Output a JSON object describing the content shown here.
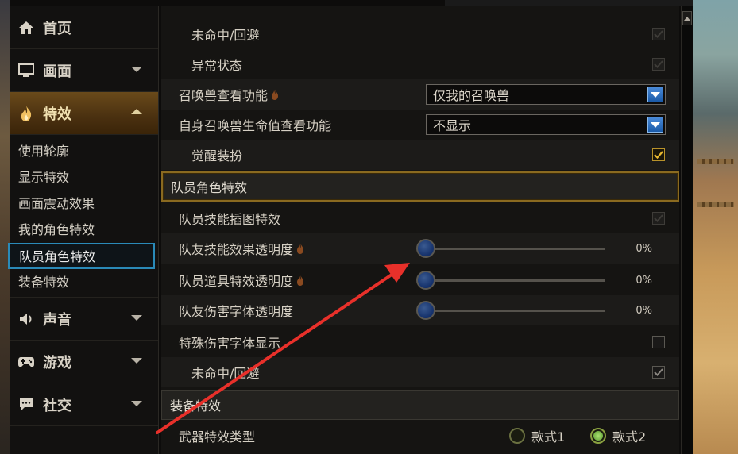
{
  "sidebar": {
    "categories": [
      {
        "label": "首页",
        "icon": "home-icon"
      },
      {
        "label": "画面",
        "icon": "monitor-icon"
      },
      {
        "label": "特效",
        "icon": "flame-icon"
      },
      {
        "label": "声音",
        "icon": "speaker-icon"
      },
      {
        "label": "游戏",
        "icon": "gamepad-icon"
      },
      {
        "label": "社交",
        "icon": "chat-icon"
      }
    ],
    "effects_sub": [
      "使用轮廓",
      "显示特效",
      "画面震动效果",
      "我的角色特效",
      "队员角色特效",
      "装备特效"
    ],
    "selected_sub": "队员角色特效"
  },
  "settings": {
    "miss_dodge_label": "未命中/回避",
    "abnormal_status_label": "异常状态",
    "summon_view_label": "召唤兽查看功能",
    "summon_view_value": "仅我的召唤兽",
    "summon_hp_label": "自身召唤兽生命值查看功能",
    "summon_hp_value": "不显示",
    "awaken_outfit_label": "觉醒装扮",
    "party_section_title": "队员角色特效",
    "party_skill_cutin_label": "队员技能插图特效",
    "ally_skill_opacity_label": "队友技能效果透明度",
    "ally_skill_opacity_value": "0%",
    "party_item_opacity_label": "队员道具特效透明度",
    "party_item_opacity_value": "0%",
    "ally_damage_font_opacity_label": "队友伤害字体透明度",
    "ally_damage_font_opacity_value": "0%",
    "special_damage_font_label": "特殊伤害字体显示",
    "party_miss_dodge_label": "未命中/回避",
    "equipment_section_title": "装备特效",
    "weapon_effect_type_label": "武器特效类型",
    "weapon_style1": "款式1",
    "weapon_style2": "款式2"
  },
  "colors": {
    "accent_gold": "#b8922a",
    "selected_blue": "#2a8ab8",
    "annotation_red": "#e8302a"
  }
}
